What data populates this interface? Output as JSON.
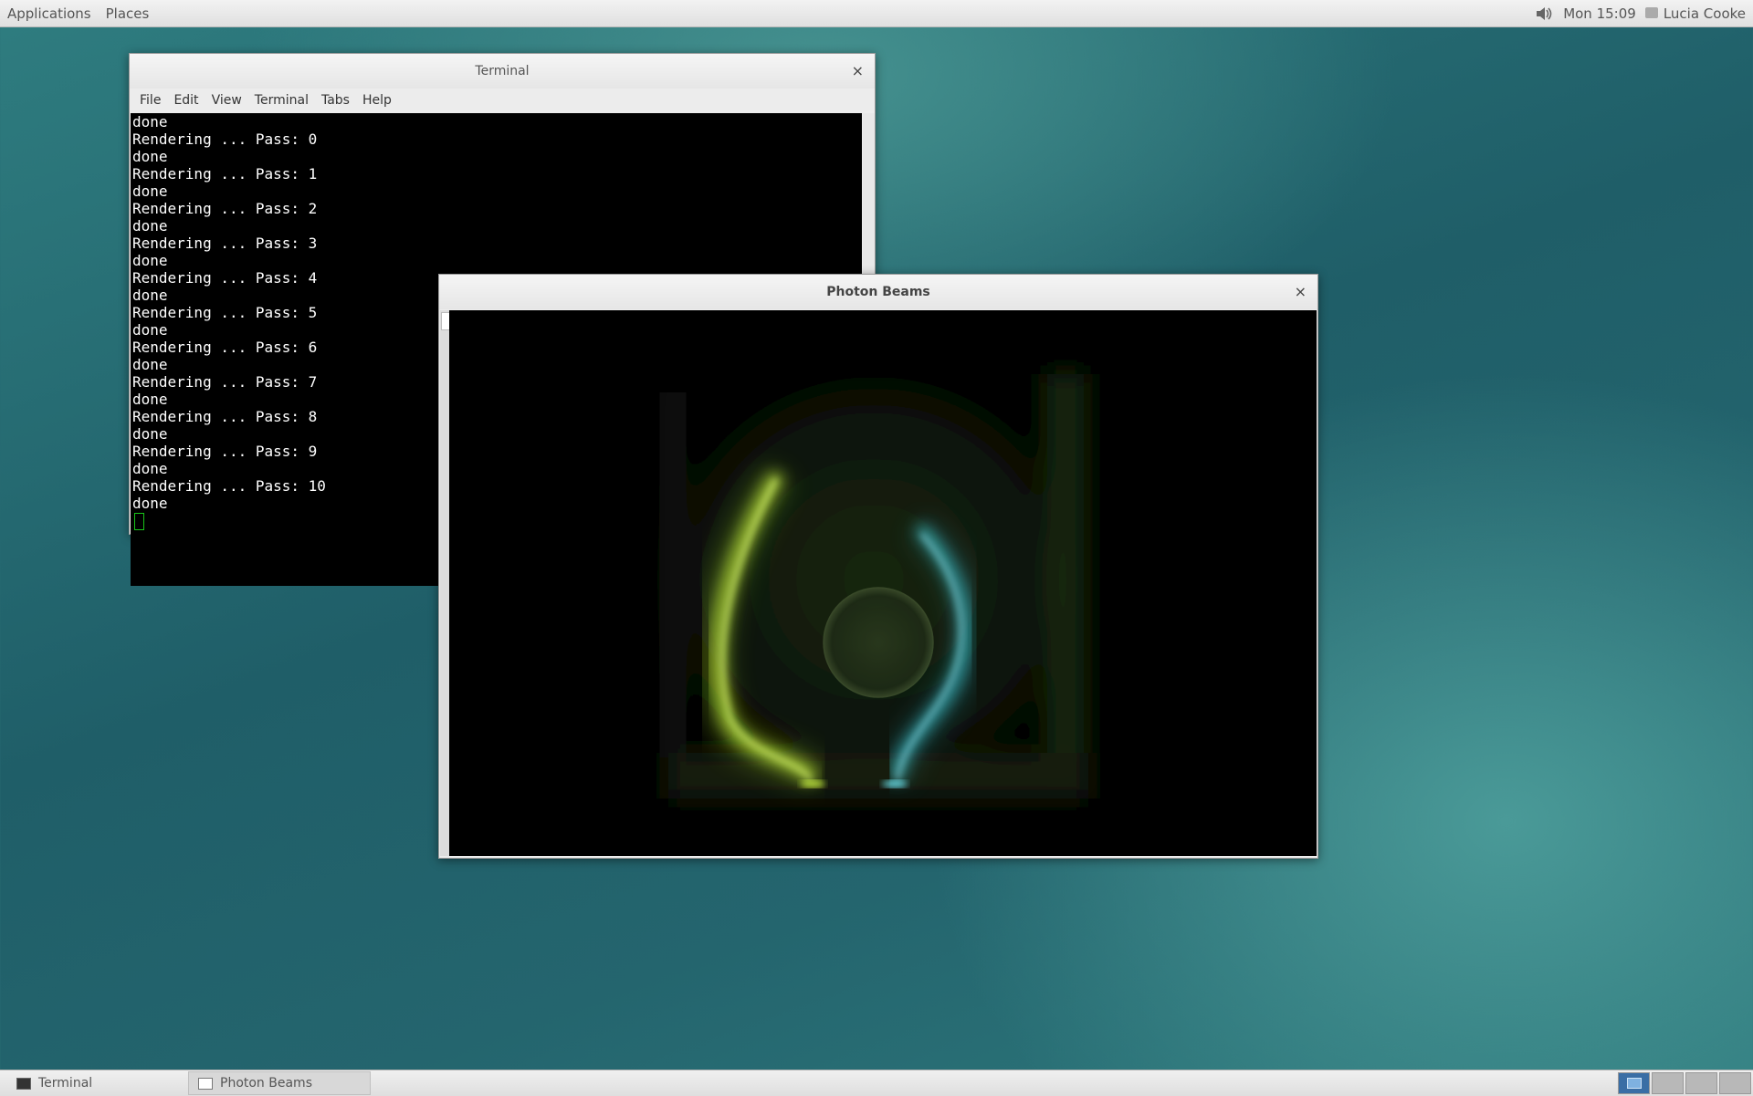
{
  "topbar": {
    "applications": "Applications",
    "places": "Places",
    "clock": "Mon 15:09",
    "user": "Lucia Cooke"
  },
  "terminal": {
    "title": "Terminal",
    "menu": [
      "File",
      "Edit",
      "View",
      "Terminal",
      "Tabs",
      "Help"
    ],
    "lines": [
      "done",
      "Rendering ... Pass: 0",
      "done",
      "Rendering ... Pass: 1",
      "done",
      "Rendering ... Pass: 2",
      "done",
      "Rendering ... Pass: 3",
      "done",
      "Rendering ... Pass: 4",
      "done",
      "Rendering ... Pass: 5",
      "done",
      "Rendering ... Pass: 6",
      "done",
      "Rendering ... Pass: 7",
      "done",
      "Rendering ... Pass: 8",
      "done",
      "Rendering ... Pass: 9",
      "done",
      "Rendering ... Pass: 10",
      "done"
    ]
  },
  "photon": {
    "title": "Photon Beams",
    "beam_colors": {
      "left": "#b8e03a",
      "right": "#3fc9d6"
    }
  },
  "taskbar": {
    "items": [
      {
        "label": "Terminal"
      },
      {
        "label": "Photon Beams"
      }
    ]
  },
  "close_glyph": "×"
}
